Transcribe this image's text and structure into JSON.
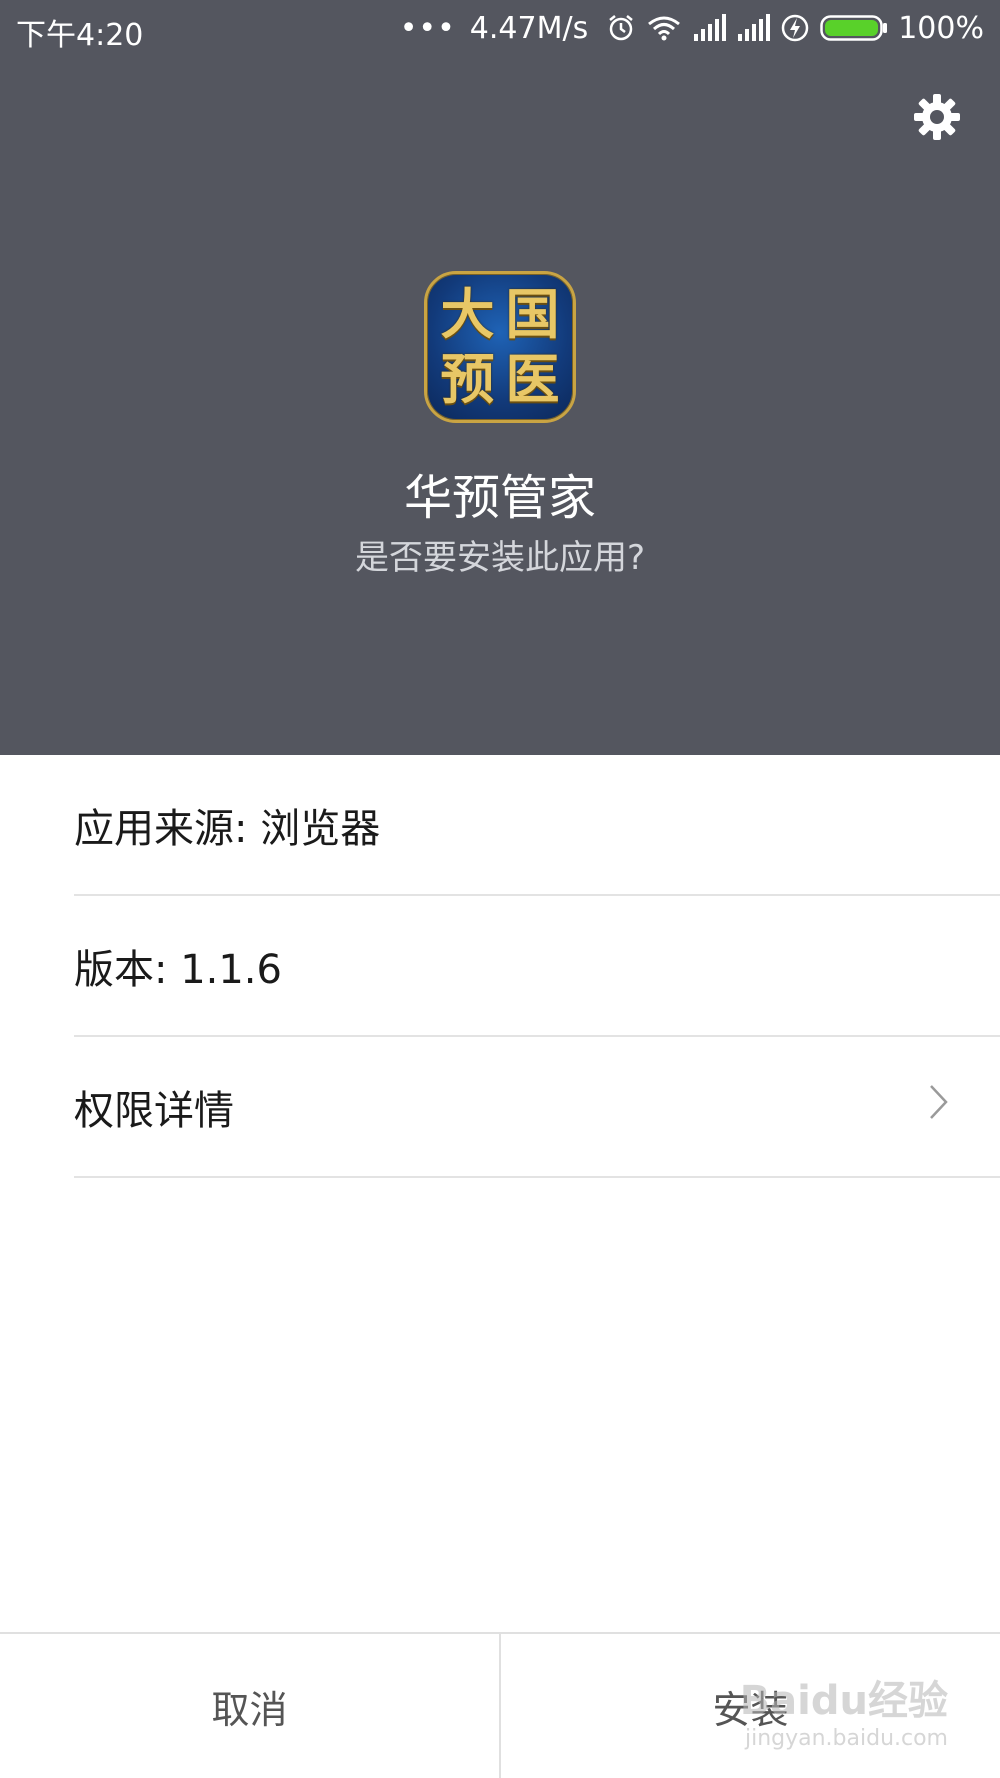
{
  "status_bar": {
    "time": "下午4:20",
    "dots": "•••",
    "speed": "4.47M/s",
    "battery_percent": "100%",
    "battery_color": "#59d12a"
  },
  "header": {
    "background": "#54565f",
    "icon_chars": [
      "大",
      "国",
      "预",
      "医"
    ],
    "app_name": "华预管家",
    "question": "是否要安装此应用?"
  },
  "info": {
    "source": "应用来源: 浏览器",
    "version": "版本: 1.1.6",
    "permissions": "权限详情"
  },
  "buttons": {
    "cancel": "取消",
    "install": "安装"
  },
  "watermark": {
    "main": "Baidu经验",
    "sub": "jingyan.baidu.com"
  }
}
